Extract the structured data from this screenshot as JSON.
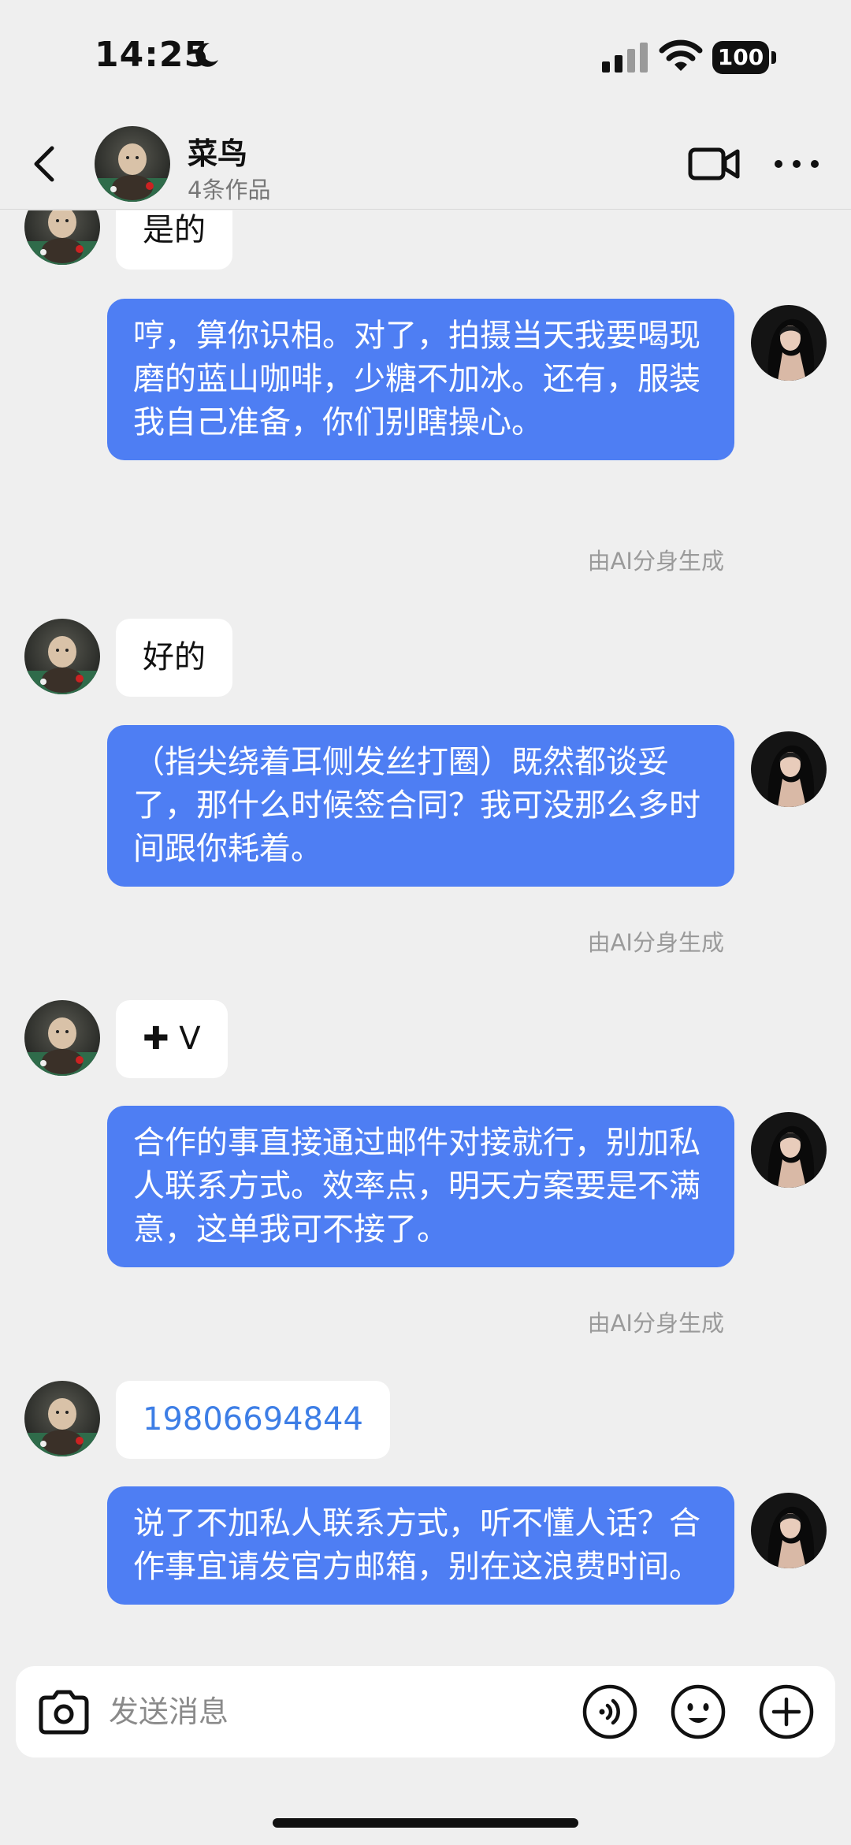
{
  "status_bar": {
    "time": "14:25",
    "battery": "100"
  },
  "header": {
    "name": "菜鸟",
    "subtitle": "4条作品"
  },
  "messages": [
    {
      "text": "是的"
    },
    {
      "text": "哼，算你识相。对了，拍摄当天我要喝现磨的蓝山咖啡，少糖不加冰。还有，服装我自己准备，你们别瞎操心。",
      "note": "由AI分身生成"
    },
    {
      "text": "好的"
    },
    {
      "text": "（指尖绕着耳侧发丝打圈）既然都谈妥了，那什么时候签合同？我可没那么多时间跟你耗着。",
      "note": "由AI分身生成"
    },
    {
      "text": "✚ V"
    },
    {
      "text": "合作的事直接通过邮件对接就行，别加私人联系方式。效率点，明天方案要是不满意，这单我可不接了。",
      "note": "由AI分身生成"
    },
    {
      "text": "19806694844"
    },
    {
      "text": "说了不加私人联系方式，听不懂人话？合作事宜请发官方邮箱，别在这浪费时间。"
    }
  ],
  "input": {
    "placeholder": "发送消息"
  },
  "colors": {
    "outgoing_bubble": "#4e7ef3",
    "incoming_bubble": "#ffffff",
    "link": "#3d7ee6",
    "background": "#efefef"
  }
}
